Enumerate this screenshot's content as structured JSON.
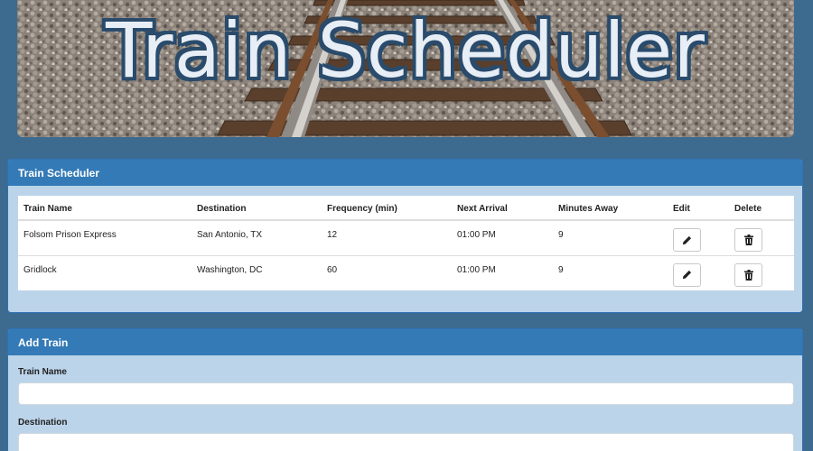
{
  "banner": {
    "title": "Train Scheduler"
  },
  "schedule": {
    "heading": "Train Scheduler",
    "columns": [
      "Train Name",
      "Destination",
      "Frequency (min)",
      "Next Arrival",
      "Minutes Away",
      "Edit",
      "Delete"
    ],
    "rows": [
      {
        "name": "Folsom Prison Express",
        "destination": "San Antonio, TX",
        "frequency": "12",
        "next_arrival": "01:00 PM",
        "minutes_away": "9"
      },
      {
        "name": "Gridlock",
        "destination": "Washington, DC",
        "frequency": "60",
        "next_arrival": "01:00 PM",
        "minutes_away": "9"
      }
    ]
  },
  "add_train": {
    "heading": "Add Train",
    "train_name_label": "Train Name",
    "train_name_value": "",
    "destination_label": "Destination",
    "destination_value": ""
  },
  "icons": {
    "edit": "pencil-icon",
    "delete": "trash-icon"
  },
  "colors": {
    "page_bg": "#3d6b8f",
    "panel_heading": "#337ab7",
    "panel_body": "#bcd4ea"
  }
}
